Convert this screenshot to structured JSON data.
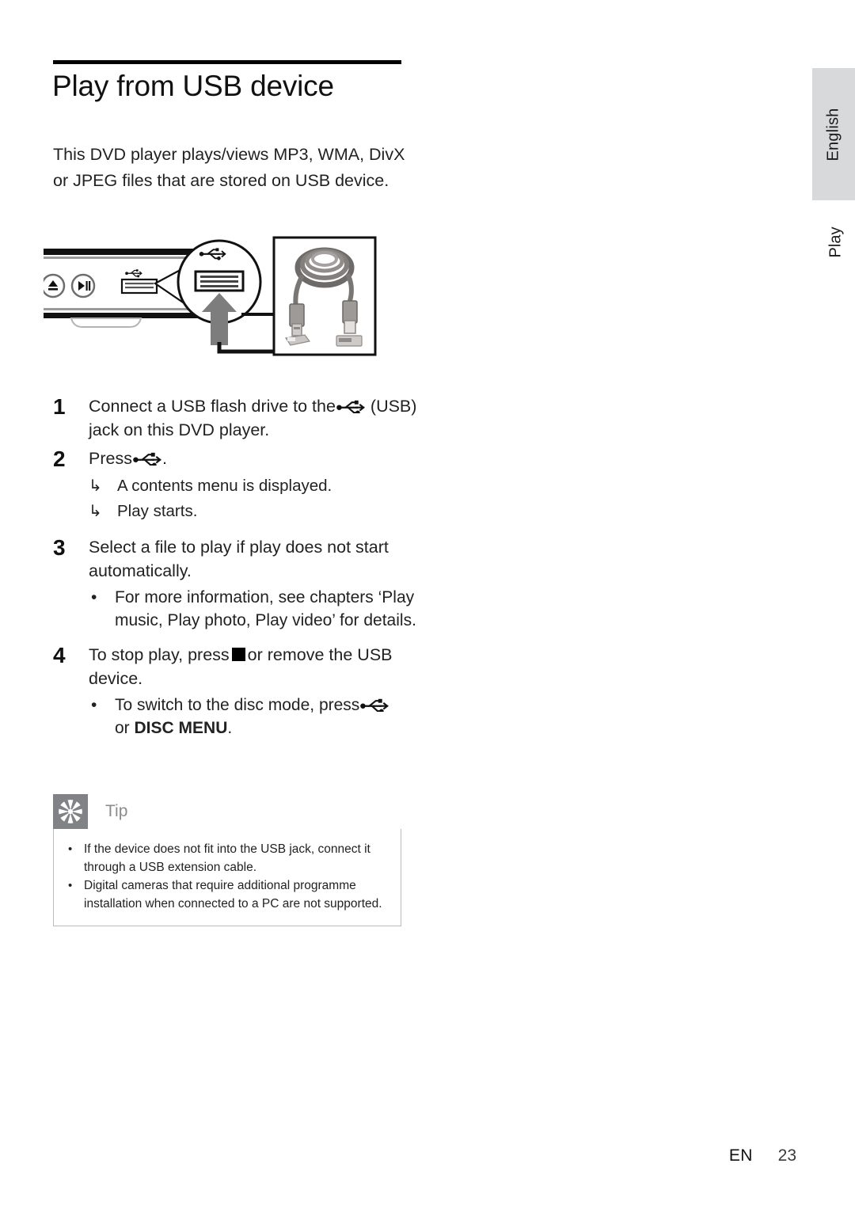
{
  "page": {
    "title": "Play from USB device",
    "intro": "This DVD player plays/views MP3, WMA, DivX or JPEG files that are stored on USB device."
  },
  "side_tabs": {
    "language": "English",
    "section": "Play",
    "language_tab_color": "#d8d9db"
  },
  "figure": {
    "name": "usb-connection-diagram",
    "caption_none": "",
    "parts": {
      "player_panel": "dvd-player-front-panel",
      "eject_button": "eject-icon",
      "play_pause_button": "play-pause-icon",
      "usb_port": "usb-port",
      "usb_port_label_icon": "usb-trident-icon",
      "magnifier_callout": "magnified-usb-jack",
      "arrow": "up-arrow",
      "photo": "usb-extension-cable-photo"
    }
  },
  "steps": [
    {
      "number": "1",
      "text_before": "Connect a USB flash drive to the",
      "icon": "usb-trident-icon",
      "text_after": "(USB) jack on this DVD player.",
      "substeps": [],
      "bullets": []
    },
    {
      "number": "2",
      "text_before": "Press",
      "icon": "usb-trident-icon",
      "text_after": ".",
      "substeps": [
        {
          "marker": "↳",
          "text": "A contents menu is displayed."
        },
        {
          "marker": "↳",
          "text": "Play starts."
        }
      ],
      "bullets": []
    },
    {
      "number": "3",
      "text_before": "Select a file to play if play does not start automatically.",
      "icon": "",
      "text_after": "",
      "substeps": [],
      "bullets": [
        {
          "marker": "•",
          "text": "For more information, see chapters ‘Play music, Play photo, Play video’ for details."
        }
      ]
    },
    {
      "number": "4",
      "text_before": "To stop play, press",
      "icon": "stop-square-icon",
      "text_after": "or remove the USB device.",
      "substeps": [],
      "bullets": [
        {
          "marker": "•",
          "text_before": "To switch to the disc mode, press",
          "icon": "usb-trident-icon",
          "text_mid": "or ",
          "text_bold": "DISC MENU",
          "text_after": "."
        }
      ]
    }
  ],
  "tip": {
    "label": "Tip",
    "icon": "asterisk-icon",
    "header_color": "#808285",
    "items": [
      {
        "marker": "•",
        "text": "If the device does not fit into the USB jack, connect it through a USB extension cable."
      },
      {
        "marker": "•",
        "text": "Digital cameras that require additional programme installation when connected to a PC are not supported."
      }
    ]
  },
  "footer": {
    "language_code": "EN",
    "page_number": "23"
  }
}
